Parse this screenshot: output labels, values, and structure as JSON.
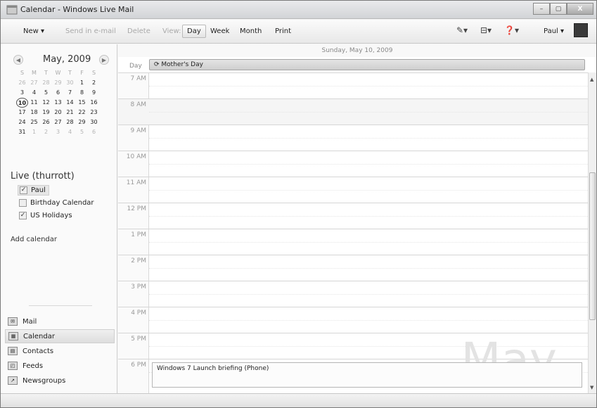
{
  "window": {
    "title": "Calendar - Windows Live Mail"
  },
  "toolbar": {
    "new": "New",
    "send": "Send in e-mail",
    "delete": "Delete",
    "view": "View:",
    "day": "Day",
    "week": "Week",
    "month": "Month",
    "print": "Print",
    "user": "Paul"
  },
  "minical": {
    "title": "May, 2009",
    "dow": [
      "S",
      "M",
      "T",
      "W",
      "T",
      "F",
      "S"
    ],
    "weeks": [
      [
        "26",
        "27",
        "28",
        "29",
        "30",
        "1",
        "2"
      ],
      [
        "3",
        "4",
        "5",
        "6",
        "7",
        "8",
        "9"
      ],
      [
        "10",
        "11",
        "12",
        "13",
        "14",
        "15",
        "16"
      ],
      [
        "17",
        "18",
        "19",
        "20",
        "21",
        "22",
        "23"
      ],
      [
        "24",
        "25",
        "26",
        "27",
        "28",
        "29",
        "30"
      ],
      [
        "31",
        "1",
        "2",
        "3",
        "4",
        "5",
        "6"
      ]
    ],
    "today": "10"
  },
  "account": {
    "title": "Live (thurrott)",
    "calendars": [
      {
        "label": "Paul",
        "checked": true
      },
      {
        "label": "Birthday Calendar",
        "checked": false
      },
      {
        "label": "US Holidays",
        "checked": true
      }
    ],
    "add_calendar": "Add calendar"
  },
  "nav": [
    "Mail",
    "Calendar",
    "Contacts",
    "Feeds",
    "Newsgroups"
  ],
  "dayview": {
    "date": "Sunday, May 10, 2009",
    "allday_label": "Day",
    "allday_event": "Mother's Day",
    "hours": [
      "7 AM",
      "8 AM",
      "9 AM",
      "10 AM",
      "11 AM",
      "12 PM",
      "1 PM",
      "2 PM",
      "3 PM",
      "4 PM",
      "5 PM",
      "6 PM"
    ],
    "event": "Windows 7 Launch briefing (Phone)",
    "watermark": "May"
  }
}
